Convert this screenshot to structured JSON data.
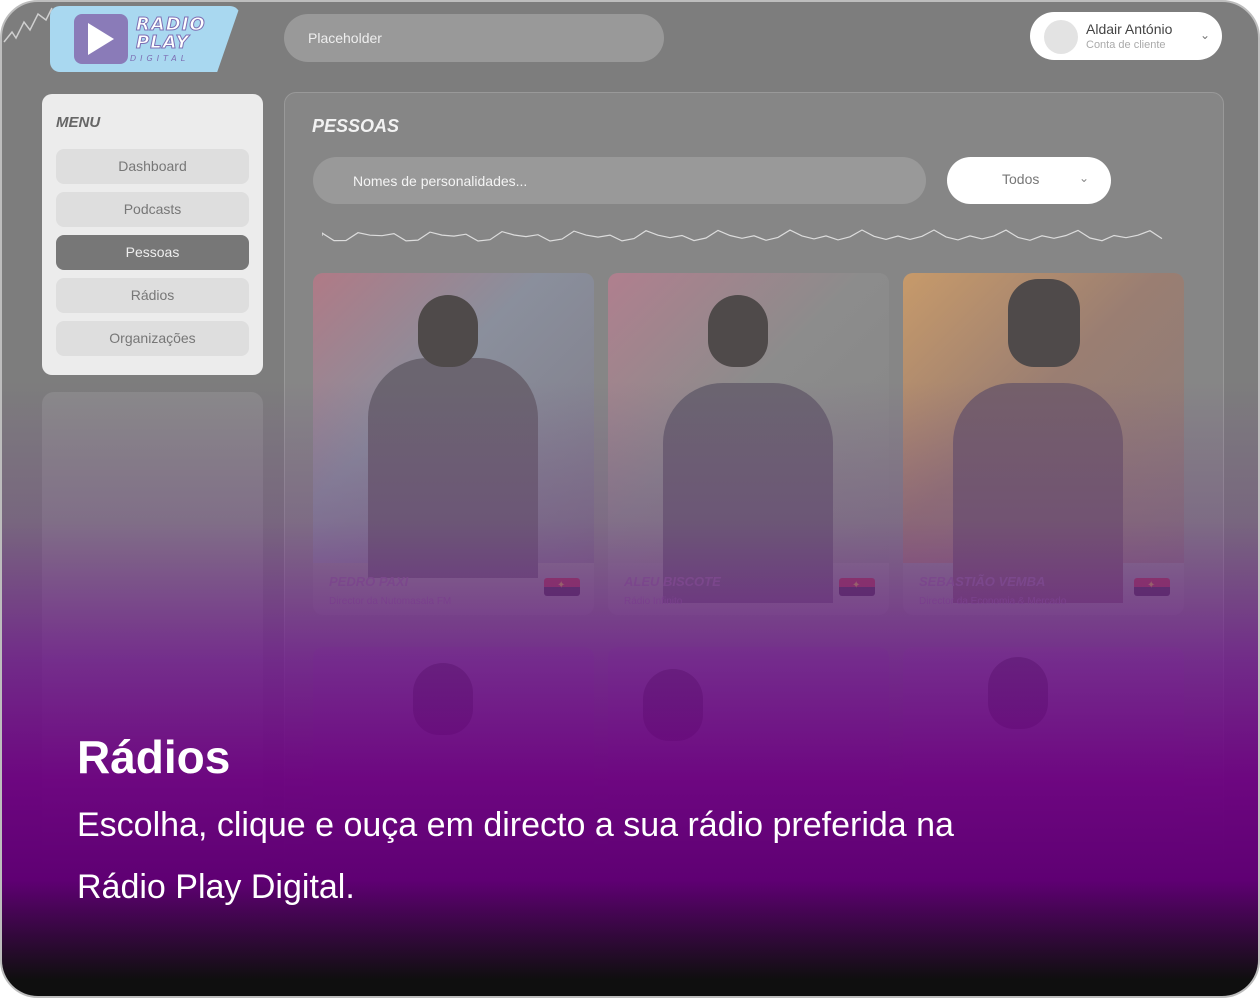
{
  "app": {
    "brand_line1": "RADIO",
    "brand_line2": "PLAY",
    "brand_line3": "DIGITAL",
    "accent_color": "#6a007f",
    "logo_bg_color": "#a9d8f0"
  },
  "header": {
    "search_placeholder": "Placeholder",
    "user": {
      "name": "Aldair António",
      "role": "Conta de cliente",
      "dropdown_icon": "chevron-down-icon"
    }
  },
  "sidebar": {
    "title": "MENU",
    "items": [
      {
        "label": "Dashboard",
        "active": false
      },
      {
        "label": "Podcasts",
        "active": false
      },
      {
        "label": "Pessoas",
        "active": true
      },
      {
        "label": "Rádios",
        "active": false
      },
      {
        "label": "Organizações",
        "active": false
      }
    ]
  },
  "main": {
    "title": "PESSOAS",
    "search_placeholder": "Nomes de personalidades...",
    "filter": {
      "selected": "Todos"
    },
    "people": [
      {
        "name": "PEDRO PAXI",
        "role": "Director da Nutomasala FM",
        "flag": "angola-flag-icon"
      },
      {
        "name": "ALEU BISCOTE",
        "role": "Rádio Infinito",
        "flag": "angola-flag-icon"
      },
      {
        "name": "SEBASTIÃO VEMBA",
        "role": "Director da Economia & Mercado",
        "flag": "angola-flag-icon"
      },
      {
        "name": "",
        "role": "",
        "flag": ""
      },
      {
        "name": "",
        "role": "",
        "flag": ""
      },
      {
        "name": "",
        "role": "",
        "flag": ""
      }
    ]
  },
  "promo": {
    "headline": "Rádios",
    "description": "Escolha, clique e ouça em directo a sua rádio preferida na Rádio Play Digital."
  }
}
